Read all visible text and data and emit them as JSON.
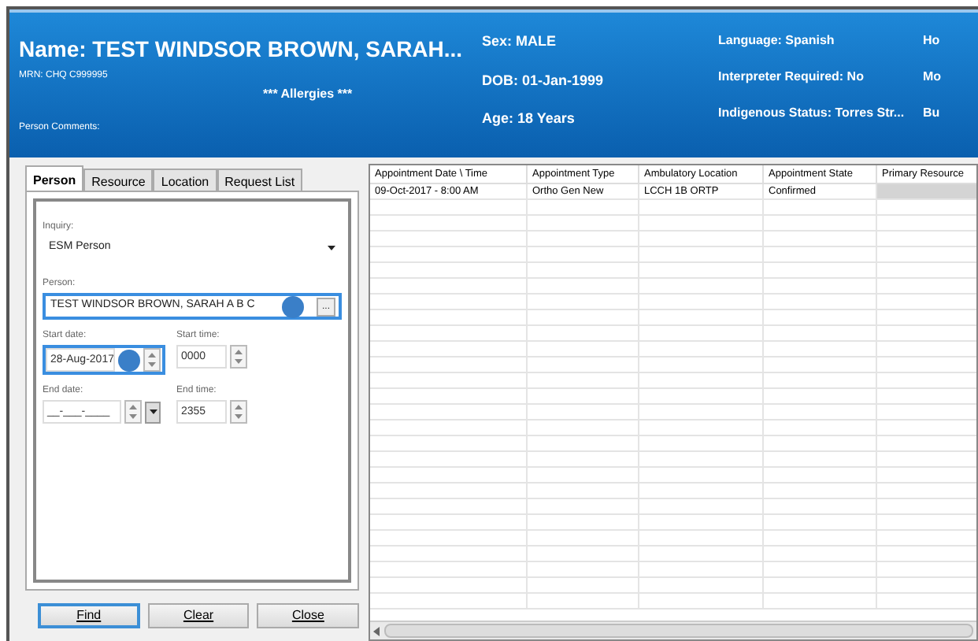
{
  "header": {
    "name": "Name: TEST WINDSOR BROWN, SARAH...",
    "mrn": "MRN: CHQ C999995",
    "allergies": "*** Allergies ***",
    "comments": "Person Comments:",
    "columns": [
      [
        "Sex: MALE",
        "DOB: 01-Jan-1999",
        "Age:  18 Years"
      ],
      [
        "Language: Spanish",
        "Interpreter Required: No",
        "Indigenous Status: Torres Str..."
      ],
      [
        "Ho",
        "Mo",
        "Bu"
      ]
    ]
  },
  "tabs": [
    {
      "label": "Person",
      "selected": true
    },
    {
      "label": "Resource",
      "selected": false
    },
    {
      "label": "Location",
      "selected": false
    },
    {
      "label": "Request List",
      "selected": false
    }
  ],
  "form": {
    "inquiry_label": "Inquiry:",
    "inquiry_value": "ESM Person",
    "person_label": "Person:",
    "person_value": "TEST WINDSOR BROWN, SARAH A B C",
    "browse_button": "...",
    "start_date_label": "Start date:",
    "start_date_value": "28-Aug-2017",
    "start_time_label": "Start time:",
    "start_time_value": "0000",
    "end_date_label": "End date:",
    "end_date_value": "__-___-____",
    "end_time_label": "End time:",
    "end_time_value": "2355"
  },
  "buttons": [
    {
      "label": "Find",
      "selected": true
    },
    {
      "label": "Clear",
      "selected": false
    },
    {
      "label": "Close",
      "selected": false
    }
  ],
  "table": {
    "columns": [
      "Appointment Date \\ Time",
      "Appointment Type",
      "Ambulatory Location",
      "Appointment State",
      "Primary Resource"
    ],
    "rows": [
      {
        "cells": [
          "09-Oct-2017 - 8:00 AM",
          "Ortho Gen New",
          "LCCH 1B ORTP",
          "Confirmed"
        ],
        "last_cell_redacted": true
      }
    ]
  }
}
